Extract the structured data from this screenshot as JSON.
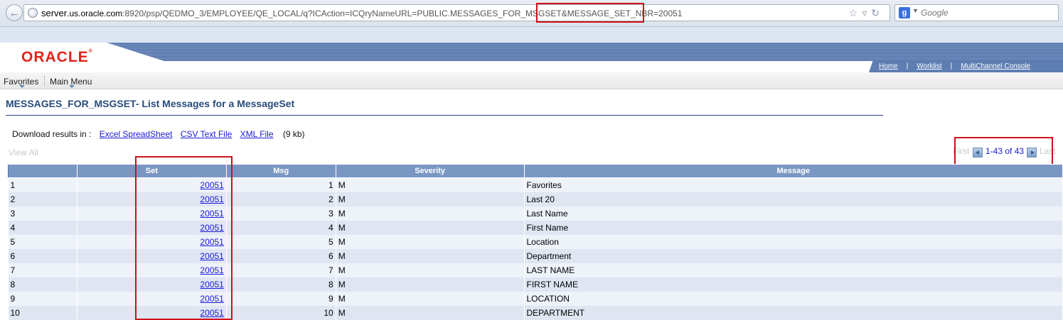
{
  "browser": {
    "url_host": "server",
    "url_domain": ".us.oracle.com",
    "url_path": ":8920/psp/QEDMO_3/EMPLOYEE/QE_LOCAL/q?ICAction=ICQryNameURL=PUBLIC.MESSAGES_FOR_MSGSET&MESSAGE_SET_NBR=20051",
    "search_placeholder": "Google",
    "search_engine_icon": "google-icon"
  },
  "header": {
    "logo": "ORACLE",
    "links": [
      "Home",
      "Worklist",
      "MultiChannel Console"
    ]
  },
  "menu": {
    "favorites": "Favorites",
    "main_menu": "Main Menu"
  },
  "page": {
    "title": "MESSAGES_FOR_MSGSET- List Messages for a MessageSet",
    "download_label": "Download results in :",
    "downloads": [
      "Excel SpreadSheet",
      "CSV Text File",
      "XML File"
    ],
    "download_size": "(9 kb)",
    "view_all": "View All"
  },
  "pager": {
    "first": "First",
    "range": "1-43 of 43",
    "last": "Last"
  },
  "table": {
    "columns": [
      "",
      "Set",
      "Msg",
      "Severity",
      "Message"
    ],
    "rows": [
      {
        "row": "1",
        "set": "20051",
        "msg": "1",
        "severity": "M",
        "message": "Favorites"
      },
      {
        "row": "2",
        "set": "20051",
        "msg": "2",
        "severity": "M",
        "message": "Last 20"
      },
      {
        "row": "3",
        "set": "20051",
        "msg": "3",
        "severity": "M",
        "message": "Last Name"
      },
      {
        "row": "4",
        "set": "20051",
        "msg": "4",
        "severity": "M",
        "message": "First Name"
      },
      {
        "row": "5",
        "set": "20051",
        "msg": "5",
        "severity": "M",
        "message": "Location"
      },
      {
        "row": "6",
        "set": "20051",
        "msg": "6",
        "severity": "M",
        "message": "Department"
      },
      {
        "row": "7",
        "set": "20051",
        "msg": "7",
        "severity": "M",
        "message": "LAST NAME"
      },
      {
        "row": "8",
        "set": "20051",
        "msg": "8",
        "severity": "M",
        "message": "FIRST NAME"
      },
      {
        "row": "9",
        "set": "20051",
        "msg": "9",
        "severity": "M",
        "message": "LOCATION"
      },
      {
        "row": "10",
        "set": "20051",
        "msg": "10",
        "severity": "M",
        "message": "DEPARTMENT"
      }
    ]
  },
  "colors": {
    "accent": "#7a96c3",
    "title": "#274b7b",
    "link": "#1a1ad6",
    "highlight": "#d0101a",
    "logo": "#e2231a"
  }
}
